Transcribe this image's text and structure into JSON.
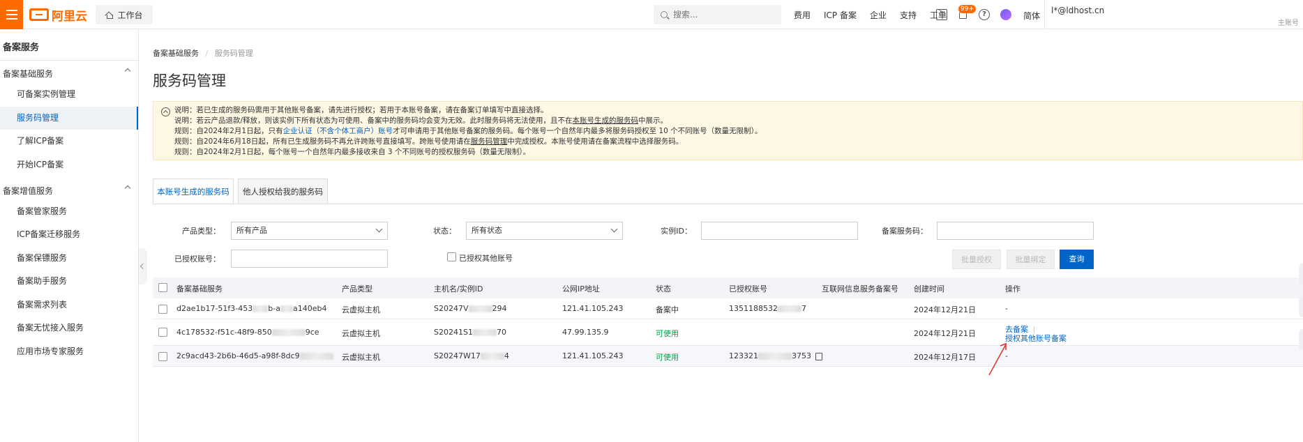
{
  "header": {
    "logo_text": "阿里云",
    "workbench": "工作台",
    "search_placeholder": "搜索...",
    "nav": [
      "费用",
      "ICP 备案",
      "企业",
      "支持",
      "工单"
    ],
    "badge": "99+",
    "language": "简体",
    "account_name": "l*@ldhost.cn",
    "account_role": "主账号",
    "icons": [
      "terminal-icon",
      "bell-icon",
      "help-icon",
      "ai-assistant-icon"
    ]
  },
  "sidebar": {
    "title": "备案服务",
    "groups": [
      {
        "label": "备案基础服务",
        "items": [
          "可备案实例管理",
          "服务码管理",
          "了解ICP备案",
          "开始ICP备案"
        ]
      },
      {
        "label": "备案增值服务",
        "items": [
          "备案管家服务",
          "ICP备案迁移服务",
          "备案保镖服务",
          "备案助手服务",
          "备案需求列表",
          "备案无忧接入服务",
          "应用市场专家服务"
        ]
      }
    ],
    "active_item": "服务码管理"
  },
  "breadcrumb": {
    "parent": "备案基础服务",
    "current": "服务码管理"
  },
  "page_title": "服务码管理",
  "notice": {
    "l1": "说明：若已生成的服务码需用于其他账号备案，请先进行授权；若用于本账号备案，请在备案订单填写中直接选择。",
    "l2a": "说明：若云产品退款/释放，则该实例下所有状态为可使用、备案中的服务码均会变为无效。此时服务码将无法使用，且不在",
    "l2link": "本账号生成的服务码",
    "l2b": "中展示。",
    "l3a": "规则：自2024年2月1日起，只有",
    "l3link": "企业认证（不含个体工商户）账号",
    "l3b": "才可申请用于其他账号备案的服务码。每个账号一个自然年内最多将服务码授权至 10 个不同账号（数量无限制）。",
    "l4a": "规则：自2024年6月18日起，所有已生成服务码不再允许跨账号直接填写。跨账号使用请在",
    "l4link": "服务码管理",
    "l4b": "中完成授权。本账号使用请在备案流程中选择服务码。",
    "l5": "规则：自2024年2月1日起，每个账号一个自然年内最多接收来自 3 个不同账号的授权服务码（数量无限制）。"
  },
  "tabs": [
    "本账号生成的服务码",
    "他人授权给我的服务码"
  ],
  "filters": {
    "product_type_label": "产品类型：",
    "product_type_value": "所有产品",
    "status_label": "状态：",
    "status_value": "所有状态",
    "instance_id_label": "实例ID：",
    "service_code_label": "备案服务码：",
    "authorized_account_label": "已授权账号：",
    "authorized_other_label": "已授权其他账号"
  },
  "buttons": {
    "batch_authorize": "批量授权",
    "batch_bind": "批量绑定",
    "query": "查询"
  },
  "table": {
    "columns": [
      "备案基础服务",
      "产品类型",
      "主机名/实例ID",
      "公网IP地址",
      "状态",
      "已授权账号",
      "互联网信息服务备案号",
      "创建时间",
      "操作"
    ],
    "rows": [
      {
        "service_a": "d2ae1b17-51f3-453",
        "service_b": "b-a",
        "service_c": "a140eb4",
        "product": "云虚拟主机",
        "host_a": "S20247V",
        "host_b": "294",
        "ip": "121.41.105.243",
        "status": "备案中",
        "account_a": "1351188532",
        "account_b": "7",
        "icp": "",
        "created": "2024年12月21日",
        "action": "-"
      },
      {
        "service_a": "4c178532-f51c-48f9-850",
        "service_b": "9ce",
        "service_c": "",
        "product": "云虚拟主机",
        "host_a": "S20241S1",
        "host_b": "70",
        "ip": "47.99.135.9",
        "status": "可使用",
        "account_a": "",
        "account_b": "",
        "icp": "",
        "created": "2024年12月21日",
        "action_1": "去备案",
        "action_2": "授权其他账号备案"
      },
      {
        "service_a": "2c9acd43-2b6b-46d5-a98f-8dc9",
        "service_b": "",
        "service_c": "",
        "product": "云虚拟主机",
        "host_a": "S20247W17",
        "host_b": "4",
        "ip": "121.41.105.243",
        "status": "可使用",
        "account_a": "123321",
        "account_b": "3753",
        "icp": "",
        "created": "2024年12月17日",
        "action": "-"
      }
    ]
  },
  "colors": {
    "accent": "#0064c8",
    "brand": "#ff6a00",
    "ok": "#06a03c",
    "notice_bg": "#fdf7e4"
  }
}
